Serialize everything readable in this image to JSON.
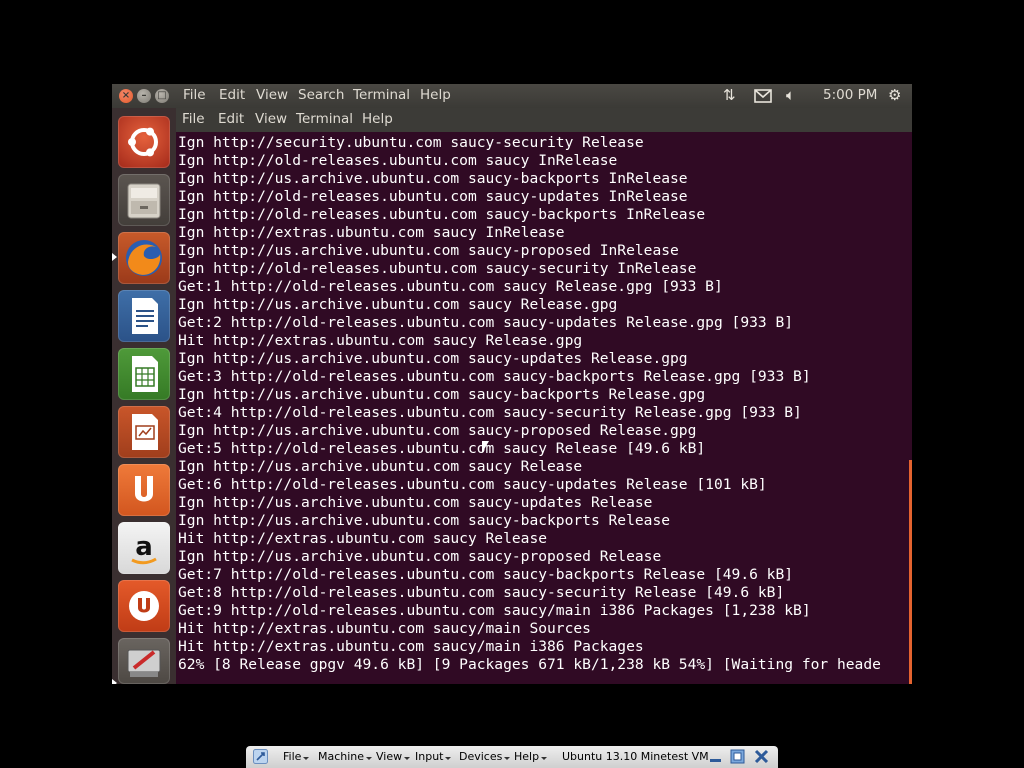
{
  "top_panel": {
    "menu": [
      "File",
      "Edit",
      "View",
      "Search",
      "Terminal",
      "Help"
    ],
    "indicators": [
      "network-icon",
      "mail-icon",
      "volume-icon",
      "power-icon"
    ],
    "clock": "5:00 PM"
  },
  "launcher": {
    "items": [
      "ubuntu-dash-icon",
      "files-icon",
      "firefox-icon",
      "libreoffice-writer-icon",
      "libreoffice-calc-icon",
      "libreoffice-impress-icon",
      "ubuntu-software-center-icon",
      "amazon-icon",
      "ubuntu-one-icon",
      "software-updater-icon"
    ]
  },
  "terminal": {
    "menu": [
      "File",
      "Edit",
      "View",
      "Terminal",
      "Help"
    ],
    "lines": [
      "Ign http://security.ubuntu.com saucy-security Release",
      "Ign http://old-releases.ubuntu.com saucy InRelease",
      "Ign http://us.archive.ubuntu.com saucy-backports InRelease",
      "Ign http://old-releases.ubuntu.com saucy-updates InRelease",
      "Ign http://old-releases.ubuntu.com saucy-backports InRelease",
      "Ign http://extras.ubuntu.com saucy InRelease",
      "Ign http://us.archive.ubuntu.com saucy-proposed InRelease",
      "Ign http://old-releases.ubuntu.com saucy-security InRelease",
      "Get:1 http://old-releases.ubuntu.com saucy Release.gpg [933 B]",
      "Ign http://us.archive.ubuntu.com saucy Release.gpg",
      "Get:2 http://old-releases.ubuntu.com saucy-updates Release.gpg [933 B]",
      "Hit http://extras.ubuntu.com saucy Release.gpg",
      "Ign http://us.archive.ubuntu.com saucy-updates Release.gpg",
      "Get:3 http://old-releases.ubuntu.com saucy-backports Release.gpg [933 B]",
      "Ign http://us.archive.ubuntu.com saucy-backports Release.gpg",
      "Get:4 http://old-releases.ubuntu.com saucy-security Release.gpg [933 B]",
      "Ign http://us.archive.ubuntu.com saucy-proposed Release.gpg",
      "Get:5 http://old-releases.ubuntu.com saucy Release [49.6 kB]",
      "Ign http://us.archive.ubuntu.com saucy Release",
      "Get:6 http://old-releases.ubuntu.com saucy-updates Release [101 kB]",
      "Ign http://us.archive.ubuntu.com saucy-updates Release",
      "Ign http://us.archive.ubuntu.com saucy-backports Release",
      "Hit http://extras.ubuntu.com saucy Release",
      "Ign http://us.archive.ubuntu.com saucy-proposed Release",
      "Get:7 http://old-releases.ubuntu.com saucy-backports Release [49.6 kB]",
      "Get:8 http://old-releases.ubuntu.com saucy-security Release [49.6 kB]",
      "Get:9 http://old-releases.ubuntu.com saucy/main i386 Packages [1,238 kB]",
      "Hit http://extras.ubuntu.com saucy/main Sources",
      "Hit http://extras.ubuntu.com saucy/main i386 Packages",
      "62% [8 Release gpgv 49.6 kB] [9 Packages 671 kB/1,238 kB 54%] [Waiting for heade"
    ]
  },
  "vbox_bar": {
    "menu": [
      "File",
      "Machine",
      "View",
      "Input",
      "Devices",
      "Help"
    ],
    "vm_title": "Ubuntu 13.10 Minetest VM"
  },
  "colors": {
    "terminal_bg": "#300a24",
    "panel_bg": "#3c3b37",
    "accent": "#e4632f"
  }
}
